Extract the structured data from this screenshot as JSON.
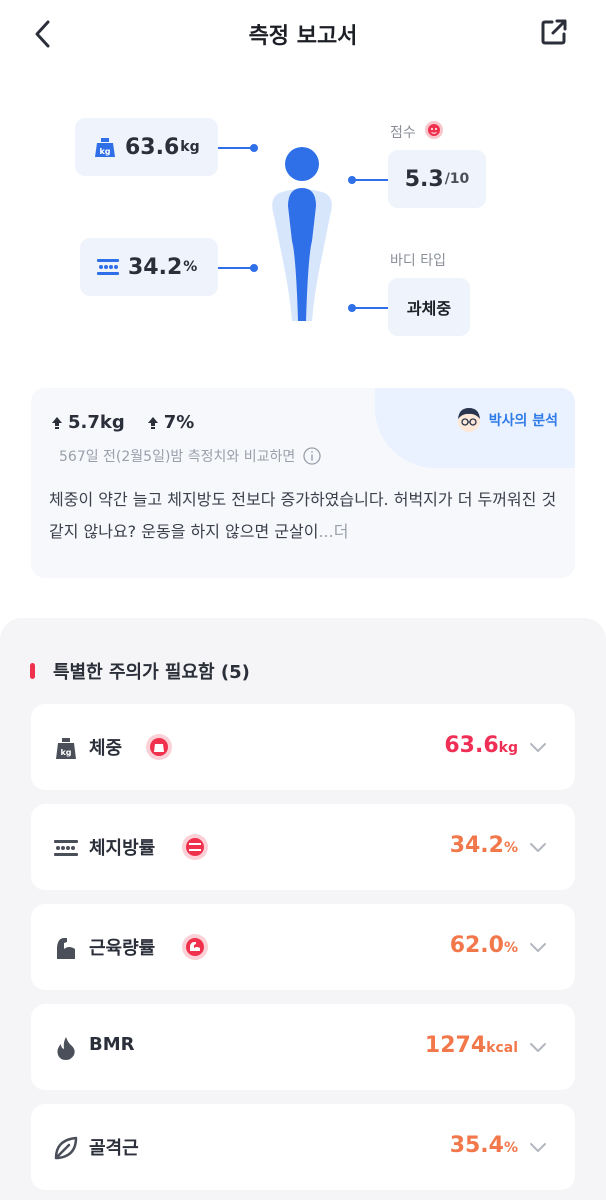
{
  "header": {
    "title": "측정 보고서"
  },
  "summary": {
    "weight": {
      "value": "63.6",
      "unit": "kg"
    },
    "fat": {
      "value": "34.2",
      "unit": "%"
    },
    "score": {
      "label": "점수",
      "value": "5.3",
      "max": "/10"
    },
    "body_type": {
      "label": "바디 타입",
      "value": "과체중"
    }
  },
  "analysis": {
    "doctor_label": "박사의 분석",
    "changes": [
      {
        "value": "5.7kg"
      },
      {
        "value": "7%"
      }
    ],
    "compare_text": "567일 전(2월5일)밤 측정치와 비교하면",
    "body_text": "체중이 약간 늘고 체지방도 전보다 증가하였습니다. 허벅지가 더 두꺼워진 것 같지 않나요? 운동을 하지 않으면 군살이",
    "more": "...더"
  },
  "attention": {
    "title": "특별한 주의가 필요함 (5)",
    "items": [
      {
        "label": "체중",
        "value": "63.6",
        "unit": "kg",
        "color": "#ef2f55",
        "icon": "weight-icon"
      },
      {
        "label": "체지방률",
        "value": "34.2",
        "unit": "%",
        "color": "#f2784b",
        "icon": "body-fat-icon"
      },
      {
        "label": "근육량률",
        "value": "62.0",
        "unit": "%",
        "color": "#f2784b",
        "icon": "muscle-icon"
      },
      {
        "label": "BMR",
        "value": "1274",
        "unit": "kcal",
        "color": "#f2784b",
        "icon": "flame-icon"
      },
      {
        "label": "골격근",
        "value": "35.4",
        "unit": "%",
        "color": "#f2784b",
        "icon": "leaf-icon"
      }
    ]
  },
  "colors": {
    "accent": "#2f6fe8",
    "alert": "#f0314e",
    "warn": "#f2784b"
  }
}
